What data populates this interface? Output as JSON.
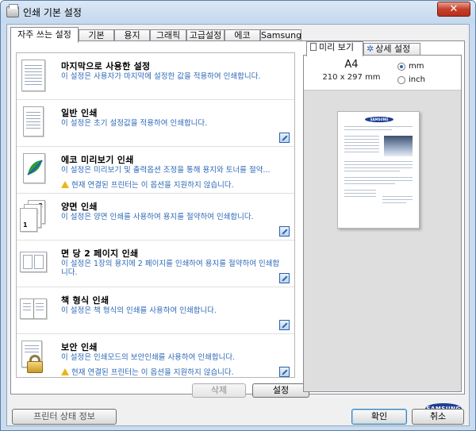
{
  "window": {
    "title": "인쇄 기본 설정",
    "close_label": "✕"
  },
  "tabs": [
    "자주 쓰는 설정",
    "기본",
    "용지",
    "그래픽",
    "고급설정",
    "에코",
    "Samsung"
  ],
  "favorites": [
    {
      "name": "마지막으로 사용한 설정",
      "desc": "이 설정은 사용자가 마지막에 설정한 값을 적용하여 인쇄합니다.",
      "warn": ""
    },
    {
      "name": "일반 인쇄",
      "desc": "이 설정은 초기 설정값을 적용하여 인쇄합니다.",
      "warn": ""
    },
    {
      "name": "에코 미리보기 인쇄",
      "desc": "이 설정은 미리보기 및 출력옵션 조정을 통해 용지와 토너를 절약...",
      "warn": "현재 연결된 프린터는 이 옵션을 지원하지 않습니다."
    },
    {
      "name": "양면 인쇄",
      "desc": "이 설정은 양면 인쇄를 사용하여 용지를 절약하여 인쇄합니다.",
      "warn": ""
    },
    {
      "name": "면 당 2 페이지 인쇄",
      "desc": "이 설정은 1장의 용지에 2 페이지를 인쇄하여 용지를 절약하여 인쇄합니다.",
      "warn": ""
    },
    {
      "name": "책 형식 인쇄",
      "desc": "이 설정은 책 형식의 인쇄를 사용하여 인쇄합니다.",
      "warn": ""
    },
    {
      "name": "보안 인쇄",
      "desc": "이 설정은 인쇄모드의 보안인쇄를 사용하여 인쇄합니다.",
      "warn": "현재 연결된 프린터는 이 옵션을 지원하지 않습니다."
    }
  ],
  "list_buttons": {
    "delete": "삭제",
    "set": "설정"
  },
  "preview_tabs": [
    "미리 보기",
    "상세 설정"
  ],
  "paper": {
    "size": "A4",
    "dims": "210 x 297 mm",
    "unit_mm": "mm",
    "unit_inch": "inch",
    "selected_unit": "mm"
  },
  "samsung_mini": "SAMSUNG",
  "brand": "SAMSUNG",
  "bottom": {
    "printer_status": "프린터 상태 정보",
    "ok": "확인",
    "cancel": "취소"
  },
  "icons": {
    "title": "printer-icon",
    "edit": "edit-favorite-icon",
    "warn": "warning-icon",
    "detail_tab": "settings-icon",
    "preview_tab": "page-icon"
  }
}
